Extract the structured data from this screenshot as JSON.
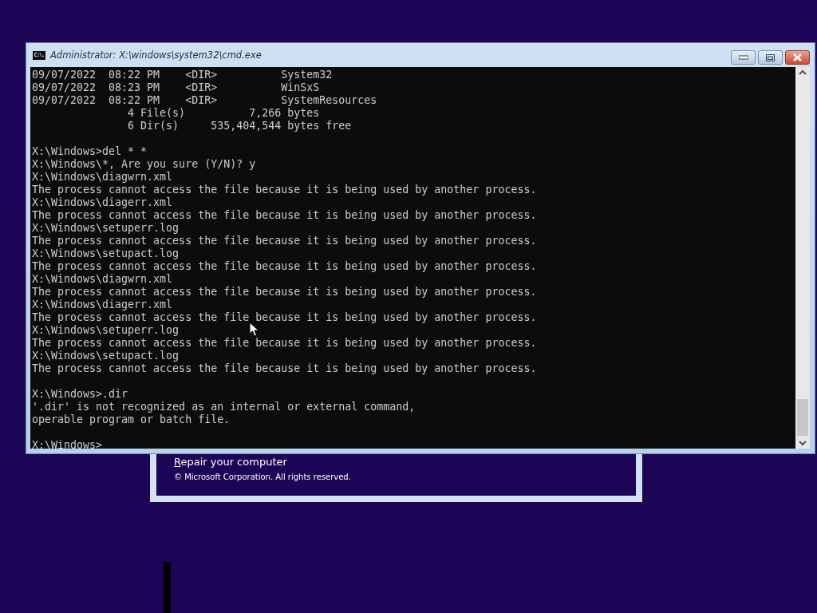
{
  "setup_window": {
    "repair_link": "Repair your computer",
    "copyright": "© Microsoft Corporation. All rights reserved."
  },
  "console_window": {
    "title": "Administrator: X:\\windows\\system32\\cmd.exe",
    "icon_text": "C:\\.",
    "output_blocks": [
      [
        "09/07/2022  08:22 PM    <DIR>          System32",
        "09/07/2022  08:23 PM    <DIR>          WinSxS",
        "09/07/2022  08:22 PM    <DIR>          SystemResources",
        "               4 File(s)          7,266 bytes",
        "               6 Dir(s)     535,404,544 bytes free"
      ],
      [
        "X:\\Windows>del * *",
        "X:\\Windows\\*, Are you sure (Y/N)? y",
        "X:\\Windows\\diagwrn.xml",
        "The process cannot access the file because it is being used by another process.",
        "X:\\Windows\\diagerr.xml",
        "The process cannot access the file because it is being used by another process.",
        "X:\\Windows\\setuperr.log",
        "The process cannot access the file because it is being used by another process.",
        "X:\\Windows\\setupact.log",
        "The process cannot access the file because it is being used by another process.",
        "X:\\Windows\\diagwrn.xml",
        "The process cannot access the file because it is being used by another process.",
        "X:\\Windows\\diagerr.xml",
        "The process cannot access the file because it is being used by another process.",
        "X:\\Windows\\setuperr.log",
        "The process cannot access the file because it is being used by another process.",
        "X:\\Windows\\setupact.log",
        "The process cannot access the file because it is being used by another process."
      ],
      [
        "X:\\Windows>.dir",
        "'.dir' is not recognized as an internal or external command,",
        "operable program or batch file."
      ],
      [
        "X:\\Windows>"
      ]
    ]
  }
}
